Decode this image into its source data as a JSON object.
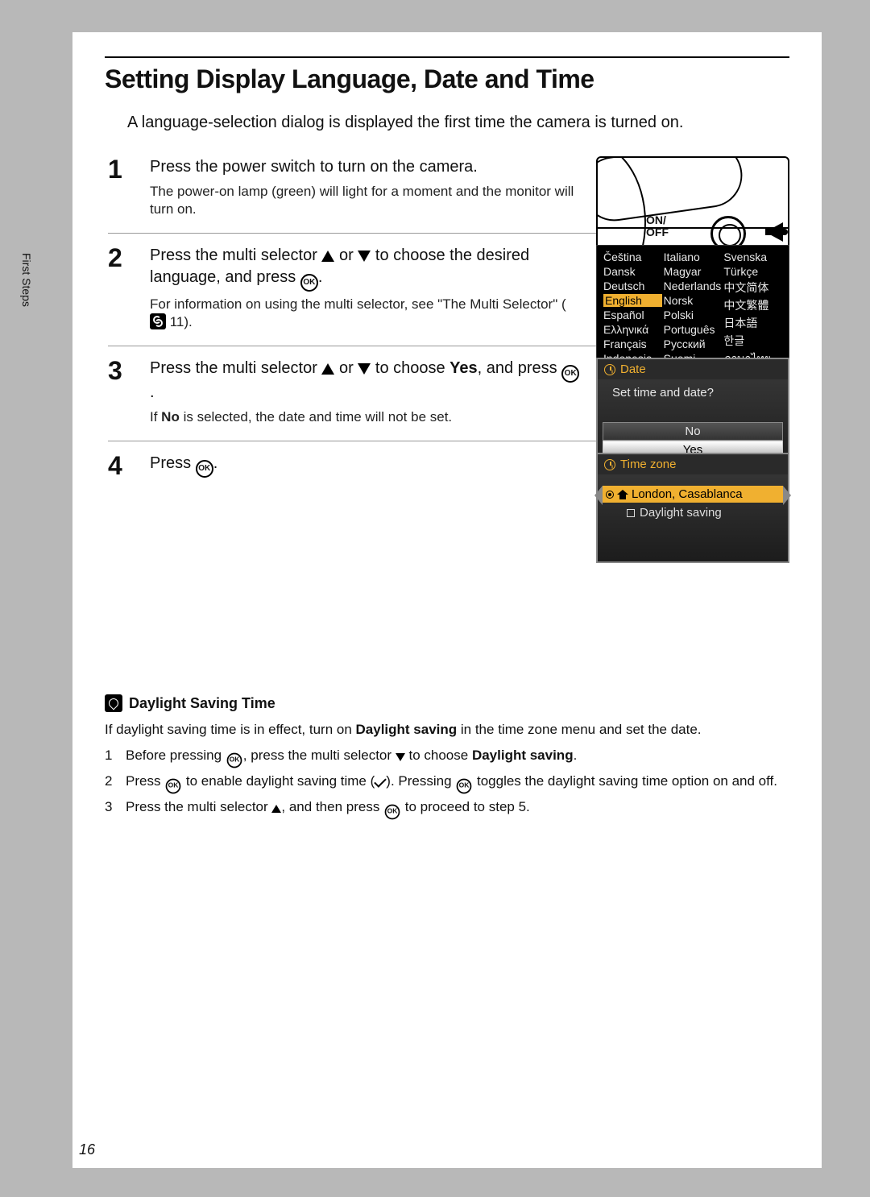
{
  "sideTab": "First Steps",
  "pageNumber": "16",
  "title": "Setting Display Language, Date and Time",
  "intro": "A language-selection dialog is displayed the first time the camera is turned on.",
  "steps": {
    "s1": {
      "num": "1",
      "lead": "Press the power switch to turn on the camera.",
      "sub": "The power-on lamp (green) will light for a moment and the monitor will turn on.",
      "onoff1": "ON/",
      "onoff2": "OFF"
    },
    "s2": {
      "num": "2",
      "lead_a": "Press the multi selector ",
      "lead_b": " or ",
      "lead_c": " to choose the desired language, and press ",
      "lead_d": ".",
      "sub_a": "For information on using the multi selector, see \"The Multi Selector\" (",
      "sub_ref": " 11).",
      "langs": {
        "c1": [
          "Čeština",
          "Dansk",
          "Deutsch",
          "English",
          "Español",
          "Ελληνικά",
          "Français",
          "Indonesia"
        ],
        "c2": [
          "Italiano",
          "Magyar",
          "Nederlands",
          "Norsk",
          "Polski",
          "Português",
          "Русский",
          "Suomi"
        ],
        "c3": [
          "Svenska",
          "Türkçe",
          "中文简体",
          "中文繁體",
          "日本語",
          "한글",
          "ภาษาไทย"
        ]
      }
    },
    "s3": {
      "num": "3",
      "lead_a": "Press the multi selector ",
      "lead_b": " or ",
      "lead_c": " to choose ",
      "lead_yes": "Yes",
      "lead_d": ", and press ",
      "lead_e": ".",
      "sub_a": "If ",
      "sub_no": "No",
      "sub_b": " is selected, the date and time will not be set.",
      "menu": {
        "title": "Date",
        "prompt": "Set time and date?",
        "no": "No",
        "yes": "Yes"
      }
    },
    "s4": {
      "num": "4",
      "lead_a": "Press ",
      "lead_b": ".",
      "menu": {
        "title": "Time zone",
        "loc": "London, Casablanca",
        "ds": "Daylight saving"
      }
    }
  },
  "note": {
    "title": "Daylight Saving Time",
    "text_a": "If daylight saving time is in effect, turn on ",
    "text_b": "Daylight saving",
    "text_c": " in the time zone menu and set the date.",
    "items": {
      "i1": {
        "n": "1",
        "a": "Before pressing ",
        "b": ", press the multi selector ",
        "c": " to choose ",
        "d": "Daylight saving",
        "e": "."
      },
      "i2": {
        "n": "2",
        "a": "Press ",
        "b": " to enable daylight saving time (",
        "c": "). Pressing ",
        "d": " toggles the daylight saving time option on and off."
      },
      "i3": {
        "n": "3",
        "a": "Press the multi selector ",
        "b": ", and then press ",
        "c": " to proceed to step 5."
      }
    }
  }
}
